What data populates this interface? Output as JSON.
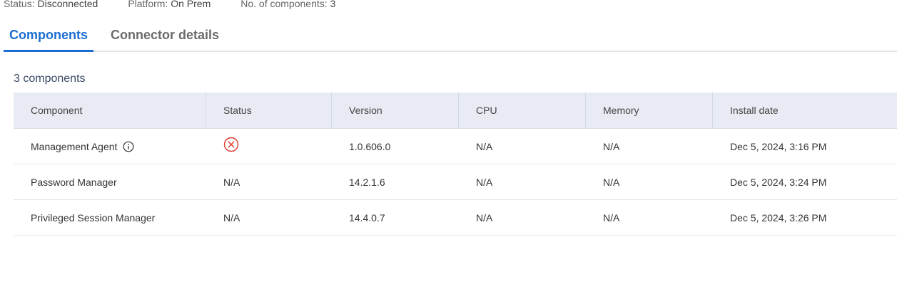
{
  "meta": {
    "status_label": "Status:",
    "status_value": "Disconnected",
    "platform_label": "Platform:",
    "platform_value": "On Prem",
    "components_label": "No. of components:",
    "components_value": "3"
  },
  "tabs": [
    {
      "label": "Components",
      "active": true
    },
    {
      "label": "Connector details",
      "active": false
    }
  ],
  "components_count": "3 components",
  "table": {
    "headers": [
      "Component",
      "Status",
      "Version",
      "CPU",
      "Memory",
      "Install date"
    ],
    "rows": [
      {
        "component": "Management Agent",
        "status": "error-icon",
        "version": "1.0.606.0",
        "cpu": "N/A",
        "memory": "N/A",
        "install_date": "Dec 5, 2024, 3:16 PM"
      },
      {
        "component": "Password Manager",
        "status": "N/A",
        "version": "14.2.1.6",
        "cpu": "N/A",
        "memory": "N/A",
        "install_date": "Dec 5, 2024, 3:24 PM"
      },
      {
        "component": "Privileged Session Manager",
        "status": "N/A",
        "version": "14.4.0.7",
        "cpu": "N/A",
        "memory": "N/A",
        "install_date": "Dec 5, 2024, 3:26 PM"
      }
    ]
  },
  "colors": {
    "accent": "#1a6ed1",
    "error": "#e0362c",
    "header_bg": "#e8ebf3"
  }
}
